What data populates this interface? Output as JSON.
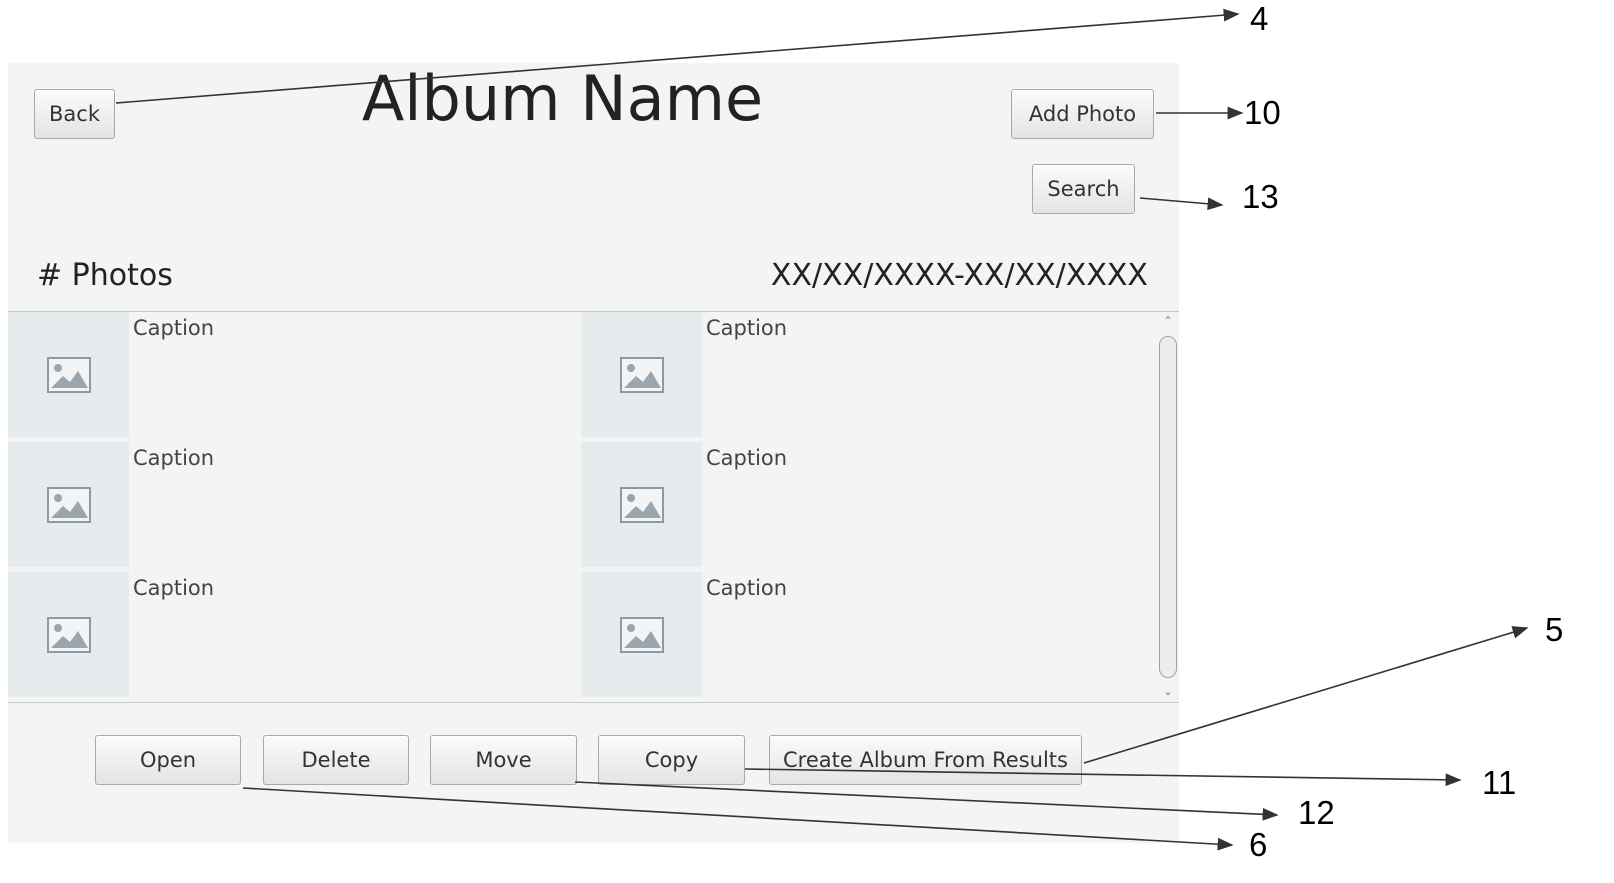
{
  "header": {
    "back_label": "Back",
    "title": "Album Name",
    "add_photo_label": "Add Photo",
    "search_label": "Search"
  },
  "info": {
    "count_label": "# Photos",
    "date_range": "XX/XX/XXXX-XX/XX/XXXX"
  },
  "photos": [
    {
      "caption": "Caption",
      "icon": "image-placeholder-icon"
    },
    {
      "caption": "Caption",
      "icon": "image-placeholder-icon"
    },
    {
      "caption": "Caption",
      "icon": "image-placeholder-icon"
    },
    {
      "caption": "Caption",
      "icon": "image-placeholder-icon"
    },
    {
      "caption": "Caption",
      "icon": "image-placeholder-icon"
    },
    {
      "caption": "Caption",
      "icon": "image-placeholder-icon"
    }
  ],
  "actions": {
    "open_label": "Open",
    "delete_label": "Delete",
    "move_label": "Move",
    "copy_label": "Copy",
    "create_album_label": "Create Album From Results"
  },
  "annotations": [
    "4",
    "10",
    "13",
    "5",
    "11",
    "12",
    "6"
  ],
  "colors": {
    "window_bg": "#f4f4f4",
    "thumb_bg": "#e6ebee",
    "button_border": "#a9a9a9"
  }
}
